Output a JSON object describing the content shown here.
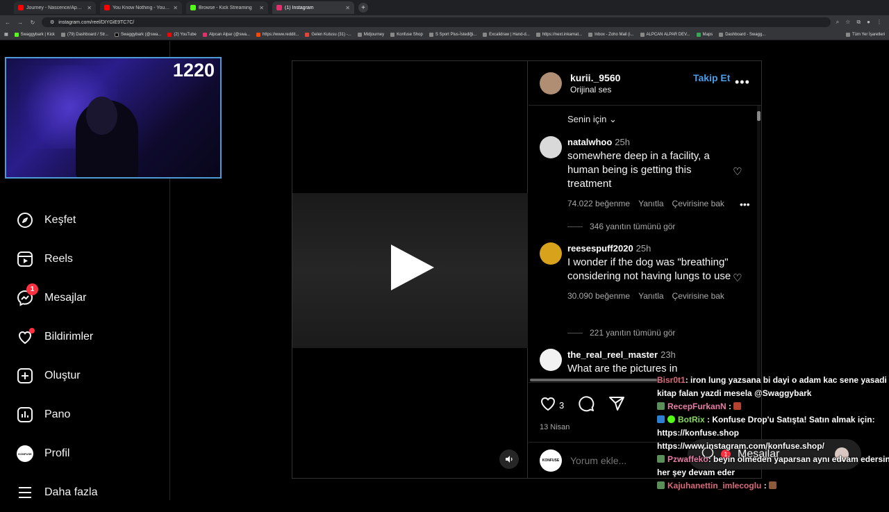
{
  "browser": {
    "tabs": [
      {
        "title": "Journey - Nascence/Apotheosis",
        "color": "#ff0000"
      },
      {
        "title": "You Know Nothing - YouTube",
        "color": "#ff0000"
      },
      {
        "title": "Browse - Kick Streaming",
        "color": "#53fc18"
      },
      {
        "title": "(1) Instagram",
        "color": "#e1306c"
      }
    ],
    "new_tab": "+",
    "url": "instagram.com/reel/DIYGiE9TC7C/",
    "bookmarks": [
      "Swaggybark | Kick",
      "(79) Dashboard / Str...",
      "Swaggybark (@swa...",
      "(2) YouTube",
      "Alpcan Alpar (@swa...",
      "https://www.reddit...",
      "Gelen Kutusu (31) -...",
      "Midjourney",
      "Konfuse Shop",
      "S Sport Plus-İstediği...",
      "Excalidraw | Hand-d...",
      "https://next.inkarnat...",
      "Inbox - Zoho Mail (i...",
      "ALPCAN ALPAR DEV...",
      "Maps",
      "Dashboard - Swagg..."
    ],
    "bookmarks_all": "Tüm Yer İşaretleri"
  },
  "webcam": {
    "count": "1220"
  },
  "sidebar": {
    "items": [
      {
        "label": "Keşfet",
        "icon": "compass-icon"
      },
      {
        "label": "Reels",
        "icon": "reels-icon"
      },
      {
        "label": "Mesajlar",
        "icon": "messenger-icon",
        "badge": "1"
      },
      {
        "label": "Bildirimler",
        "icon": "heart-icon"
      },
      {
        "label": "Oluştur",
        "icon": "plus-square-icon"
      },
      {
        "label": "Pano",
        "icon": "dashboard-icon"
      },
      {
        "label": "Profil",
        "icon": "avatar-icon",
        "avatar_text": "KONFUSE"
      },
      {
        "label": "Daha fazla",
        "icon": "menu-icon"
      }
    ]
  },
  "reel": {
    "author": "kurii._9560",
    "audio": "Orijinal ses",
    "follow": "Takip Et",
    "more": "•••",
    "sort": "Senin için",
    "comments": [
      {
        "user": "natalwhoo",
        "time": "25h",
        "text": "somewhere deep in a facility, a human being is getting this treatment",
        "likes": "74.022 beğenme",
        "reply": "Yanıtla",
        "translate": "Çevirisine bak",
        "replies": "346 yanıtın tümünü gör"
      },
      {
        "user": "reesespuff2020",
        "time": "25h",
        "text": "I wonder if the dog was \"breathing\" considering not having lungs to use",
        "likes": "30.090 beğenme",
        "reply": "Yanıtla",
        "translate": "Çevirisine bak",
        "replies": "221 yanıtın tümünü gör"
      },
      {
        "user": "the_real_reel_master",
        "time": "23h",
        "text": "What are the pictures in"
      }
    ],
    "like_count": "3",
    "date": "13 Nisan",
    "add_comment_placeholder": "Yorum ekle...",
    "commenter_avatar": "KONFUSE"
  },
  "chat": [
    {
      "user": "Bisr0t1",
      "msg": ": iron lung yazsana bi dayi o adam kac sene yasadi",
      "cls": "u1"
    },
    {
      "user": "",
      "msg": "kitap falan yazdi mesela @Swaggybark",
      "cls": "u4"
    },
    {
      "user": "RecepFurkanN",
      "msg": " :",
      "cls": "u2"
    },
    {
      "user": "BotRix",
      "msg": ": Konfuse Drop'u Satışta! Satın almak için:",
      "cls": "u3"
    },
    {
      "user": "",
      "msg": "https://konfuse.shop",
      "cls": "u4"
    },
    {
      "user": "",
      "msg": "https://www.instagram.com/konfuse.shop/",
      "cls": "u4"
    },
    {
      "user": "Pzwaffeko",
      "msg": ": beyin olmeden yaparsan aynı edvam edersin",
      "cls": "u2"
    },
    {
      "user": "",
      "msg": "her şey devam eder",
      "cls": "u4"
    },
    {
      "user": "Kajuhanettin_imlecoglu",
      "msg": " :",
      "cls": "u1"
    }
  ],
  "messages_pill": {
    "label": "Mesajlar",
    "badge": "1"
  }
}
